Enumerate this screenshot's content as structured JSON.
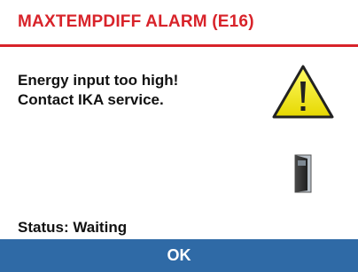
{
  "dialog": {
    "title": "MAXTEMPDIFF ALARM (E16)",
    "message_lines": [
      "Energy input too high!",
      "Contact IKA service."
    ],
    "status": "Status: Waiting",
    "ok_label": "OK"
  },
  "icons": {
    "warning": "warning-triangle-icon",
    "device": "device-door-icon"
  },
  "colors": {
    "title": "#d8232a",
    "divider": "#d8232a",
    "button_bg": "#2f6aa6",
    "button_text": "#ffffff",
    "warning_fill": "#f3e900",
    "text": "#111111"
  }
}
